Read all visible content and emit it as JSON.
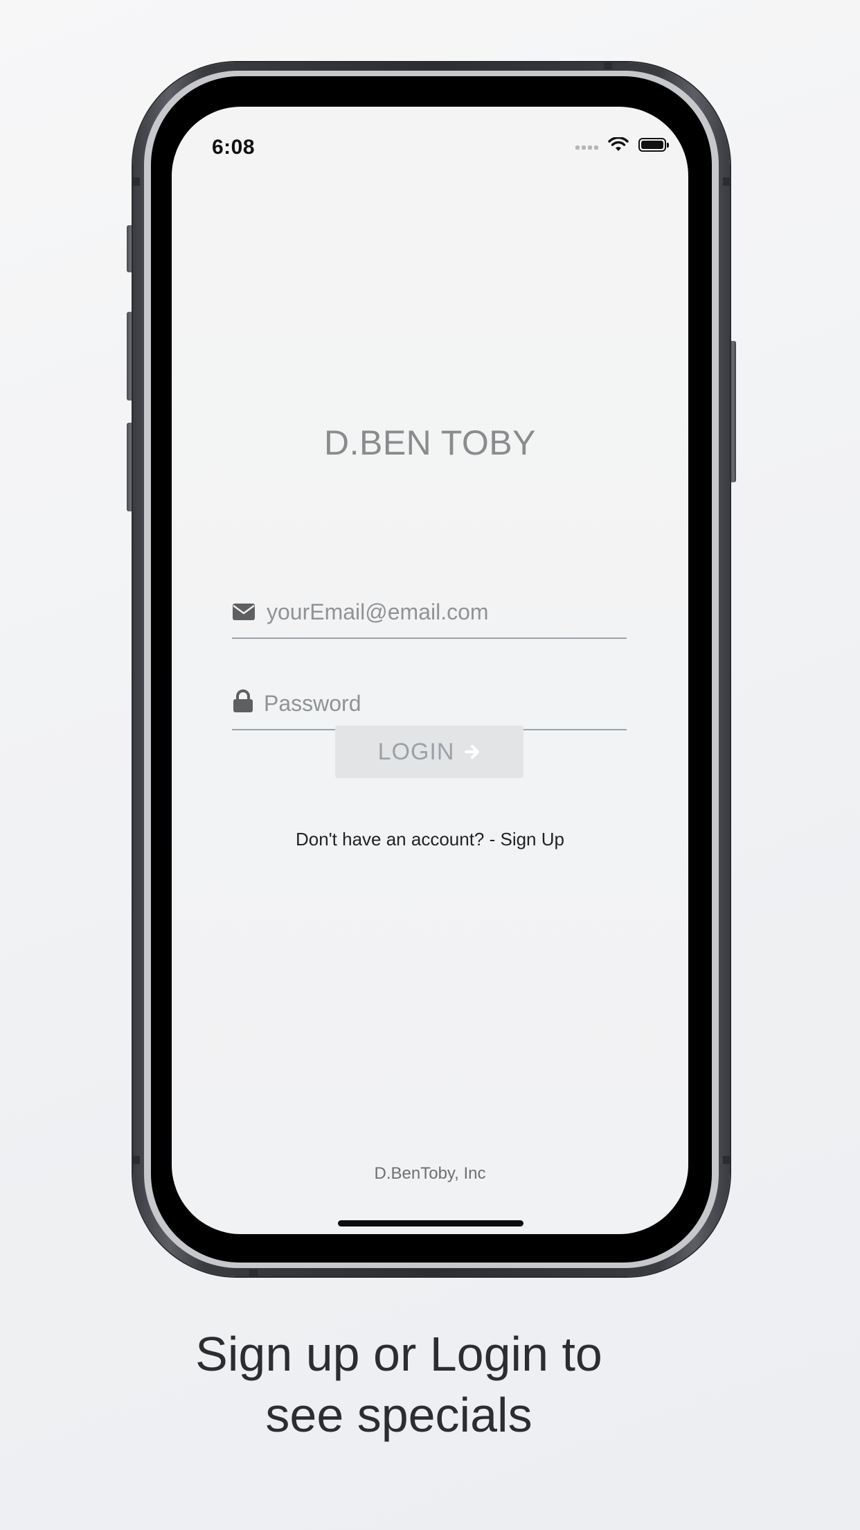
{
  "status_bar": {
    "time": "6:08"
  },
  "app": {
    "brand_title": "D.BEN TOBY",
    "email": {
      "placeholder": "yourEmail@email.com",
      "value": ""
    },
    "password": {
      "placeholder": "Password",
      "value": ""
    },
    "login_button": {
      "label": "LOGIN"
    },
    "signup_link": "Don't have an account? - Sign Up",
    "footer_company": "D.BenToby, Inc"
  },
  "caption": {
    "line1": "Sign up or Login to",
    "line2": "see specials"
  },
  "icons": {
    "email": "envelope-icon",
    "password": "lock-icon",
    "login": "arrow-right-icon"
  },
  "colors": {
    "title_gray": "#8a8b8d",
    "icon_gray": "#5e5f61",
    "field_underline": "#9aa4ad",
    "button_bg": "#e2e4e6",
    "button_text": "#9ba1a6"
  }
}
